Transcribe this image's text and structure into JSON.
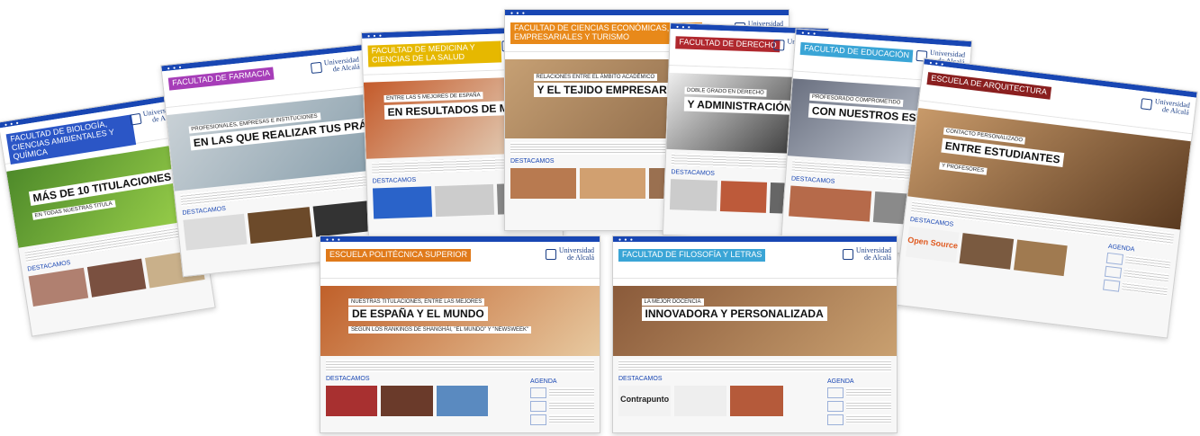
{
  "screens": [
    {
      "id": "biologia",
      "title": "Facultad de Biología, Ciencias Ambientales y Química",
      "accent": "#2b56c6",
      "hero_top": "",
      "hero_main": "Más de 10 titulaciones",
      "hero_sub": "en todas nuestras titula",
      "dest": "Destacamos"
    },
    {
      "id": "farmacia",
      "title": "Facultad de Farmacia",
      "accent": "#a63db8",
      "hero_top": "Profesionales, empresas e instituciones",
      "hero_main": "en las que realizar tus prácticas",
      "hero_sub": "",
      "dest": "Destacamos"
    },
    {
      "id": "medicina",
      "title": "Facultad de Medicina y Ciencias de la Salud",
      "accent": "#e6b800",
      "hero_top": "Entre las 5 mejores de España",
      "hero_main": "en resultados de MIR y",
      "hero_sub": "",
      "dest": "Destacamos"
    },
    {
      "id": "economicas",
      "title": "Facultad de Ciencias Económicas, Empresariales y Turismo",
      "accent": "#e8891a",
      "hero_top": "Relaciones entre el ámbito académico",
      "hero_main": "y el tejido empresarial",
      "hero_sub": "",
      "dest": "Destacamos"
    },
    {
      "id": "derecho",
      "title": "Facultad de Derecho",
      "accent": "#b0282e",
      "hero_top": "Doble grado en Derecho",
      "hero_main": "y Administración y Dire",
      "hero_sub": "",
      "dest": "Destacamos"
    },
    {
      "id": "educacion",
      "title": "Facultad de Educación",
      "accent": "#3aa5d6",
      "hero_top": "Profesorado comprometido",
      "hero_main": "con nuestros estud",
      "hero_sub": "",
      "dest": "Destacamos"
    },
    {
      "id": "arquitectura",
      "title": "Escuela de Arquitectura",
      "accent": "#8a1f1f",
      "hero_top": "Contacto personalizado",
      "hero_main": "entre estudiantes",
      "hero_sub": "y profesores",
      "dest": "Destacamos",
      "agenda": "Agenda",
      "thumb": "Open Source"
    },
    {
      "id": "politecnica",
      "title": "Escuela Politécnica Superior",
      "accent": "#e07a1a",
      "hero_top": "Nuestras titulaciones, entre las mejores",
      "hero_main": "de España y el mundo",
      "hero_sub": "según los rankings de Shanghái, \"el mundo\" y \"newsweek\"",
      "dest": "Destacamos",
      "agenda": "Agenda"
    },
    {
      "id": "filosofia",
      "title": "Facultad de Filosofía y Letras",
      "accent": "#3aa5d6",
      "hero_top": "La mejor docencia",
      "hero_main": "innovadora y personalizada",
      "hero_sub": "",
      "dest": "Destacamos",
      "agenda": "Agenda",
      "thumb": "Contrapunto"
    }
  ],
  "logo": {
    "line1": "Universidad",
    "line2": "de Alcalá"
  },
  "colors": {
    "topbar": "#1846b3",
    "link": "#1846b3"
  }
}
